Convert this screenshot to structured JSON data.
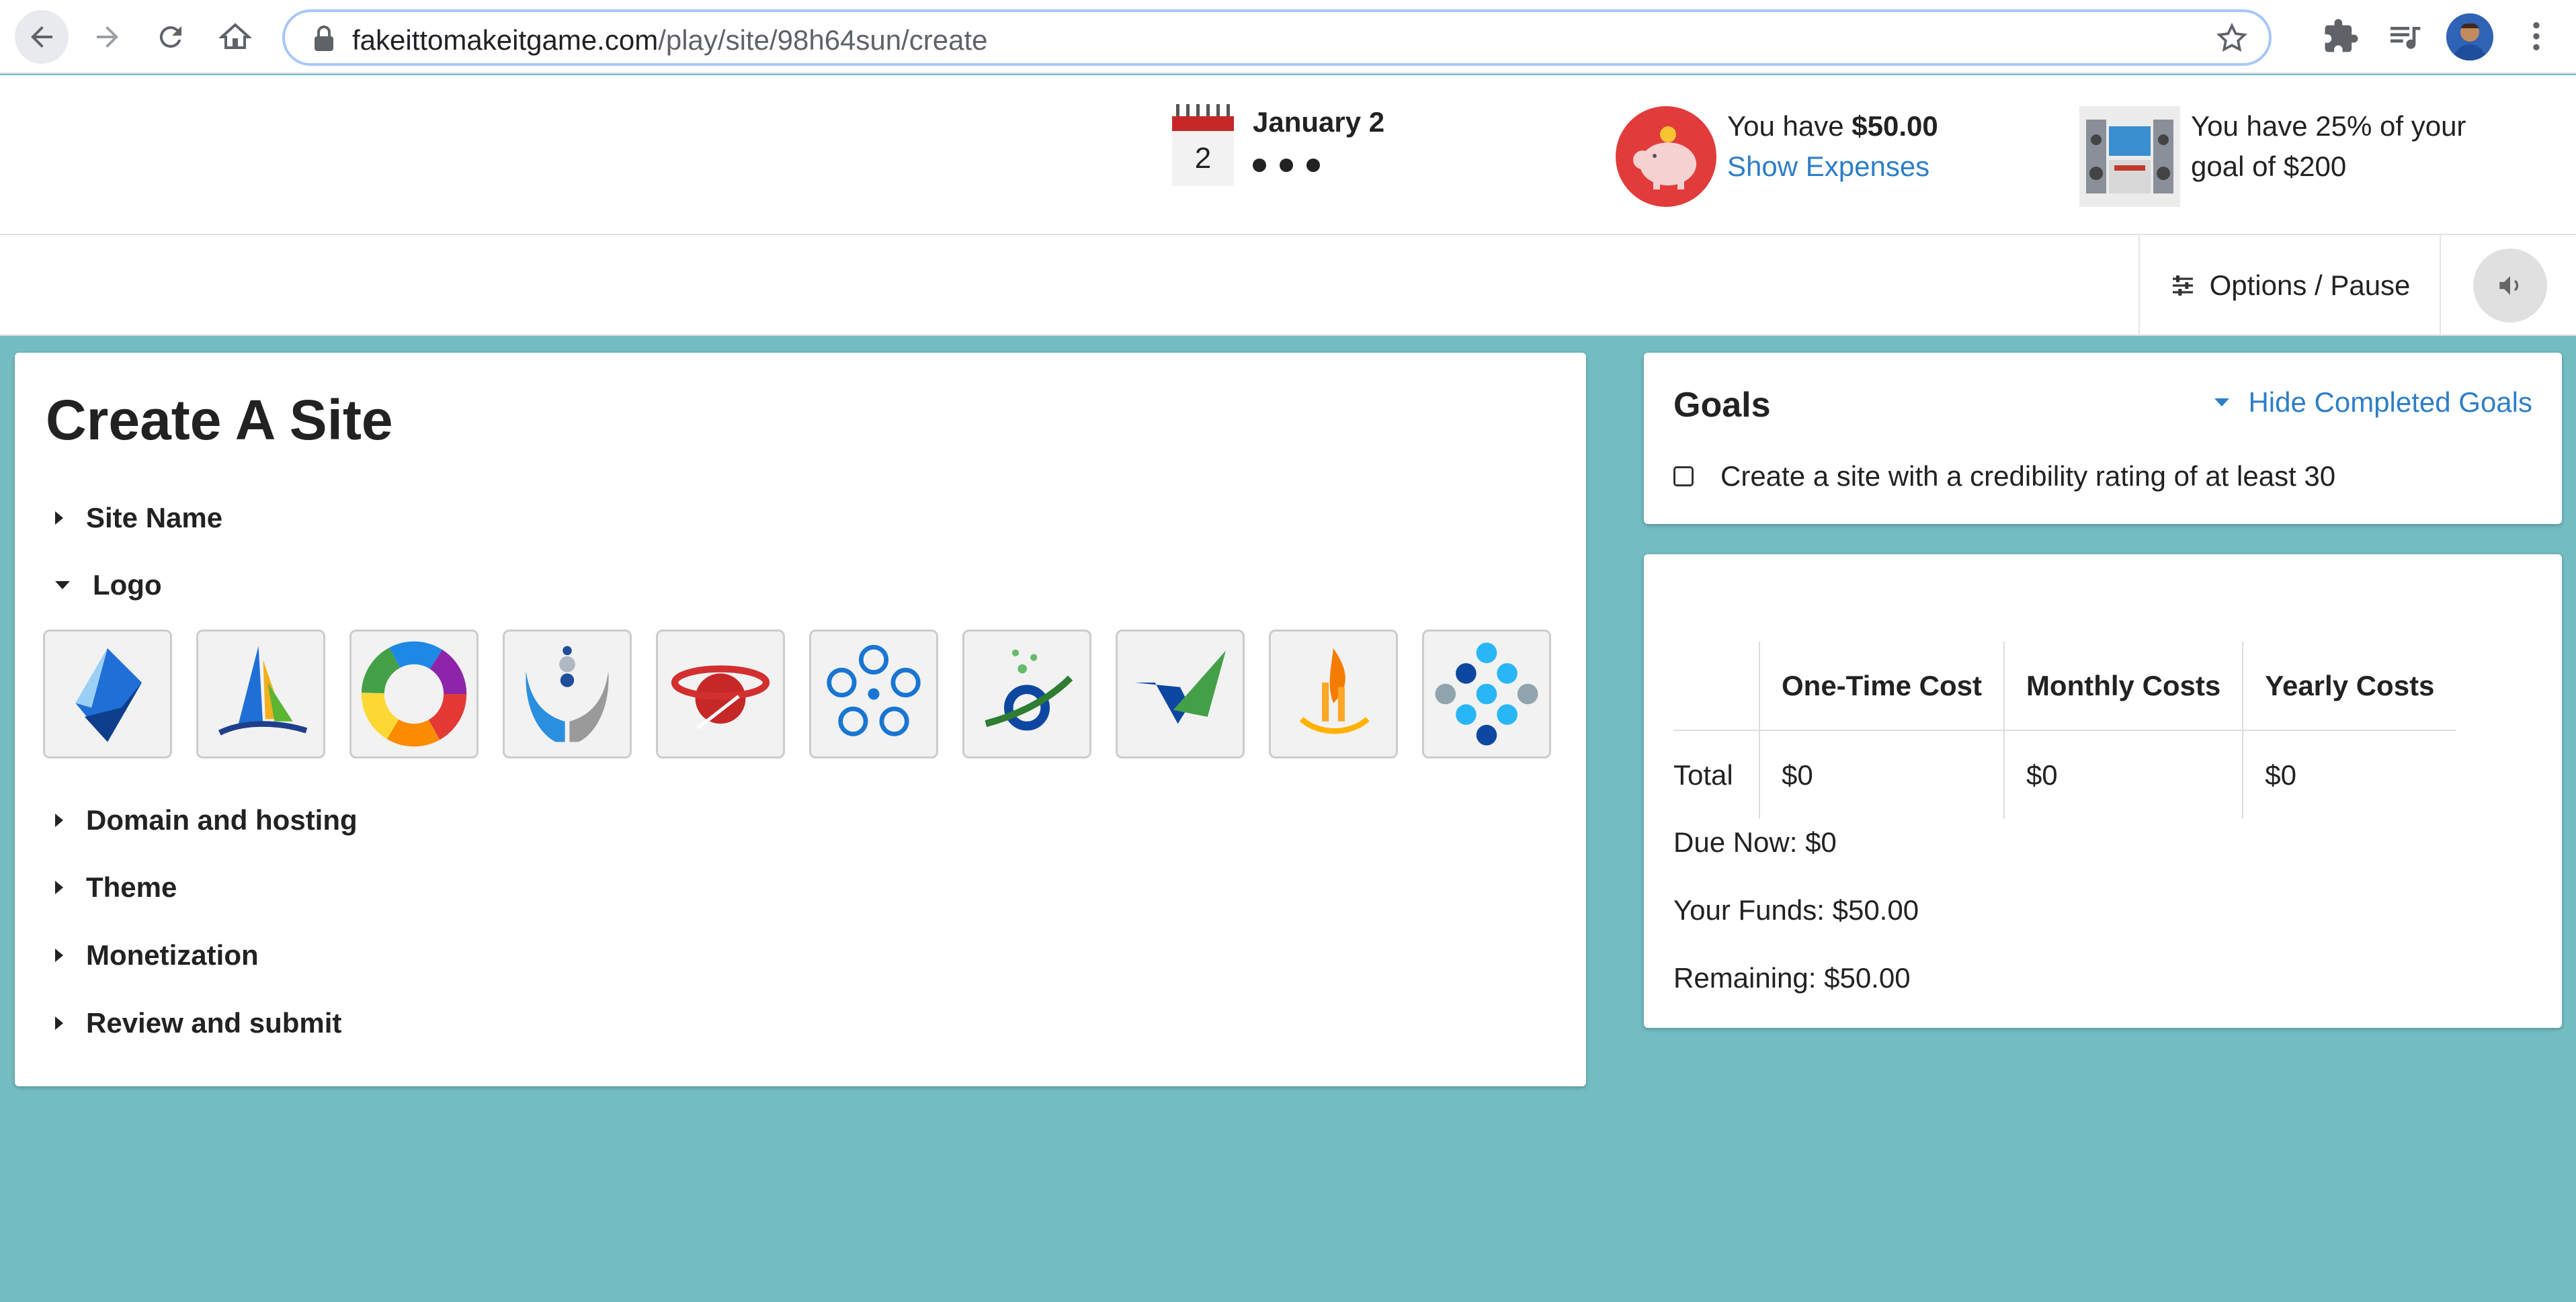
{
  "browser": {
    "url_domain": "fakeittomakeitgame.com",
    "url_path": "/play/site/98h64sun/create"
  },
  "header": {
    "calendar_day": "2",
    "date_label": "January 2",
    "funds_prefix": "You have ",
    "funds_amount": "$50.00",
    "show_expenses": "Show Expenses",
    "goal_line1": "You have 25% of your",
    "goal_line2": "goal of $200"
  },
  "toolbar": {
    "options_label": "Options / Pause"
  },
  "create_site": {
    "title": "Create A Site",
    "sections": {
      "site_name": "Site Name",
      "logo": "Logo",
      "domain": "Domain and hosting",
      "theme": "Theme",
      "monetization": "Monetization",
      "review": "Review and submit"
    },
    "logo_count": 10
  },
  "goals": {
    "title": "Goals",
    "hide_label": "Hide Completed Goals",
    "items": [
      {
        "label": "Create a site with a credibility rating of at least 30",
        "checked": false
      }
    ]
  },
  "costs": {
    "headers": [
      "One-Time Cost",
      "Monthly Costs",
      "Yearly Costs"
    ],
    "row_label": "Total",
    "values": [
      "$0",
      "$0",
      "$0"
    ],
    "due_now": "Due Now: $0",
    "your_funds": "Your Funds: $50.00",
    "remaining": "Remaining: $50.00"
  },
  "colors": {
    "background": "#72bcc2",
    "link": "#2d7fc6",
    "piggy": "#e23b3b"
  }
}
